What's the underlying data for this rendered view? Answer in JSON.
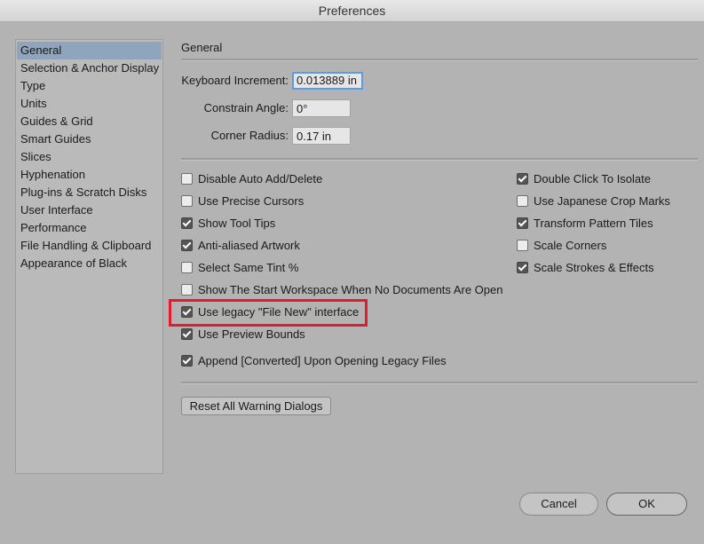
{
  "window": {
    "title": "Preferences"
  },
  "sidebar": {
    "items": [
      {
        "label": "General",
        "selected": true
      },
      {
        "label": "Selection & Anchor Display"
      },
      {
        "label": "Type"
      },
      {
        "label": "Units"
      },
      {
        "label": "Guides & Grid"
      },
      {
        "label": "Smart Guides"
      },
      {
        "label": "Slices"
      },
      {
        "label": "Hyphenation"
      },
      {
        "label": "Plug-ins & Scratch Disks"
      },
      {
        "label": "User Interface"
      },
      {
        "label": "Performance"
      },
      {
        "label": "File Handling & Clipboard"
      },
      {
        "label": "Appearance of Black"
      }
    ]
  },
  "main": {
    "section_title": "General",
    "fields": [
      {
        "label": "Keyboard Increment:",
        "value": "0.013889 in"
      },
      {
        "label": "Constrain Angle:",
        "value": "0°"
      },
      {
        "label": "Corner Radius:",
        "value": "0.17 in"
      }
    ],
    "left_checks": [
      {
        "label": "Disable Auto Add/Delete",
        "checked": false
      },
      {
        "label": "Use Precise Cursors",
        "checked": false
      },
      {
        "label": "Show Tool Tips",
        "checked": true
      },
      {
        "label": "Anti-aliased Artwork",
        "checked": true
      },
      {
        "label": "Select Same Tint %",
        "checked": false
      },
      {
        "label": "Show The Start Workspace When No Documents Are Open",
        "checked": false
      },
      {
        "label": "Use legacy \"File New\" interface",
        "checked": true
      },
      {
        "label": "Use Preview Bounds",
        "checked": true
      },
      {
        "label": "Append [Converted] Upon Opening Legacy Files",
        "checked": true
      }
    ],
    "right_checks": [
      {
        "label": "Double Click To Isolate",
        "checked": true
      },
      {
        "label": "Use Japanese Crop Marks",
        "checked": false
      },
      {
        "label": "Transform Pattern Tiles",
        "checked": true
      },
      {
        "label": "Scale Corners",
        "checked": false
      },
      {
        "label": "Scale Strokes & Effects",
        "checked": true
      }
    ],
    "reset_label": "Reset All Warning Dialogs"
  },
  "footer": {
    "cancel_label": "Cancel",
    "ok_label": "OK"
  },
  "colors": {
    "highlight": "#e8192c",
    "selection": "#8ea5bd"
  }
}
